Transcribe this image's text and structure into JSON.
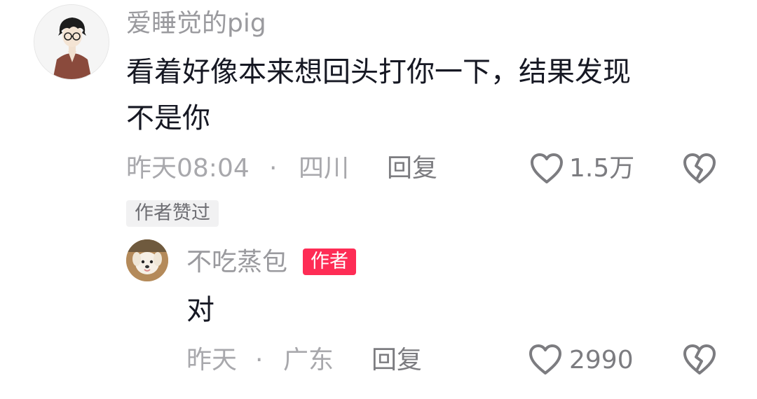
{
  "comment": {
    "username": "爱睡觉的pig",
    "text_line1": "看着好像本来想回头打你一下，结果发现",
    "text_line2": "不是你",
    "time": "昨天08:04",
    "separator": "·",
    "location": "四川",
    "reply_label": "回复",
    "like_count": "1.5万",
    "liked_by_author_tag": "作者赞过"
  },
  "reply": {
    "username": "不吃蒸包",
    "author_badge": "作者",
    "text": "对",
    "time": "昨天",
    "separator": "·",
    "location": "广东",
    "reply_label": "回复",
    "like_count": "2990"
  },
  "colors": {
    "author_badge_bg": "#fe2c55",
    "meta_text": "#a8a8ac",
    "body_text": "#161823"
  },
  "icons": {
    "like": "heart-outline-icon",
    "dislike": "broken-heart-icon"
  }
}
